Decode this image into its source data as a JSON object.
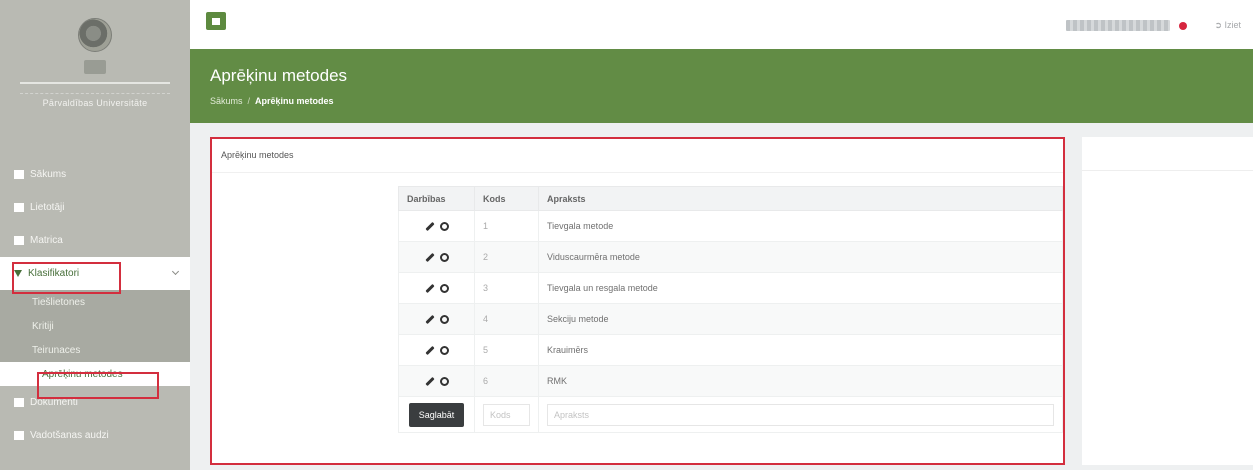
{
  "sidebar": {
    "logo_text": "Pārvaldības Universitāte",
    "items": [
      {
        "label": "Sākums"
      },
      {
        "label": "Lietotāji"
      },
      {
        "label": "Matrica"
      },
      {
        "label": "Klasifikatori"
      },
      {
        "label": "Dokumenti"
      },
      {
        "label": "Vadotšanas audzi"
      }
    ],
    "sub_items": [
      {
        "label": "Tiešlietones"
      },
      {
        "label": "Kritiji"
      },
      {
        "label": "Teirunaces"
      },
      {
        "label": "Aprēķinu metodes"
      }
    ]
  },
  "topbar": {
    "exit_label": "Iziet"
  },
  "header": {
    "title": "Aprēķinu metodes",
    "breadcrumb_home": "Sākums",
    "breadcrumb_sep": "/",
    "breadcrumb_current": "Aprēķinu metodes"
  },
  "panel": {
    "title": "Aprēķinu metodes"
  },
  "table": {
    "headers": {
      "actions": "Darbības",
      "code": "Kods",
      "desc": "Apraksts"
    },
    "rows": [
      {
        "code": "1",
        "desc": "Tievgala metode"
      },
      {
        "code": "2",
        "desc": "Viduscaurmēra metode"
      },
      {
        "code": "3",
        "desc": "Tievgala un resgala metode"
      },
      {
        "code": "4",
        "desc": "Sekciju metode"
      },
      {
        "code": "5",
        "desc": "Krauimērs"
      },
      {
        "code": "6",
        "desc": "RMK"
      }
    ],
    "save_label": "Saglabāt",
    "code_placeholder": "Kods",
    "desc_placeholder": "Apraksts"
  },
  "colors": {
    "brand_green": "#628c45",
    "highlight_red": "#d32e3e"
  }
}
